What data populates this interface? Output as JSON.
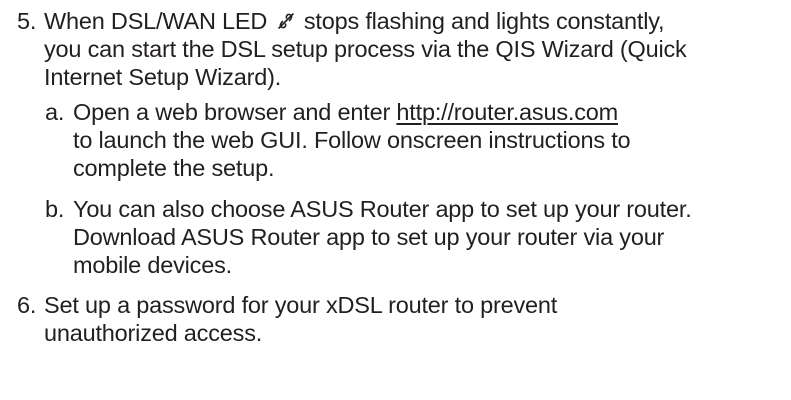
{
  "steps": [
    {
      "number": "5.",
      "line1_before_icon": "When DSL/WAN LED",
      "line1_icon": "dsl-wan-led-icon",
      "line1_after_icon": "stops flashing and lights constantly,",
      "line2": "you can start the DSL setup process via the QIS Wizard (Quick",
      "line3": "Internet Setup Wizard).",
      "substeps": [
        {
          "letter": "a.",
          "line1_before_link": "Open a web browser and enter",
          "link": "http://router.asus.com",
          "line2": "to launch the web GUI. Follow onscreen instructions to",
          "line3": "complete the setup."
        },
        {
          "letter": "b.",
          "line1": "You can also choose ASUS Router app to set up your router.",
          "line2": "Download ASUS Router app to set up your router via your",
          "line3": "mobile devices."
        }
      ]
    },
    {
      "number": "6.",
      "line1": "Set up a password for your xDSL router to prevent",
      "line2": "unauthorized access."
    }
  ]
}
